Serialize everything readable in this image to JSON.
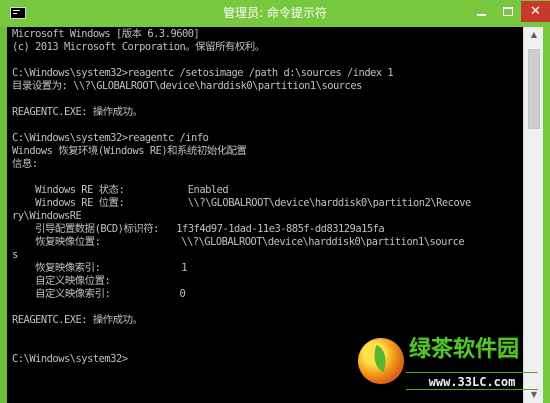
{
  "window": {
    "title": "管理员: 命令提示符",
    "minimize_label": "",
    "maximize_label": "",
    "close_label": "✕",
    "accent_color": "#78c83f",
    "close_color": "#c7382d"
  },
  "console": {
    "lines": [
      "Microsoft Windows [版本 6.3.9600]",
      "(c) 2013 Microsoft Corporation。保留所有权利。",
      "",
      "C:\\Windows\\system32>reagentc /setosimage /path d:\\sources /index 1",
      "目录设置为: \\\\?\\GLOBALROOT\\device\\harddisk0\\partition1\\sources",
      "",
      "REAGENTC.EXE: 操作成功。",
      "",
      "C:\\Windows\\system32>reagentc /info",
      "Windows 恢复环境(Windows RE)和系统初始化配置",
      "信息:",
      "",
      "    Windows RE 状态:           Enabled",
      "    Windows RE 位置:           \\\\?\\GLOBALROOT\\device\\harddisk0\\partition2\\Recove",
      "ry\\WindowsRE",
      "    引导配置数据(BCD)标识符:   1f3f4d97-1dad-11e3-885f-dd83129a15fa",
      "    恢复映像位置:              \\\\?\\GLOBALROOT\\device\\harddisk0\\partition1\\source",
      "s",
      "    恢复映像索引:              1",
      "    自定义映像位置:",
      "    自定义映像索引:            0",
      "",
      "REAGENTC.EXE: 操作成功。",
      "",
      "",
      "C:\\Windows\\system32>"
    ]
  },
  "scrollbar": {
    "up_arrow": "▲",
    "down_arrow": "▼"
  },
  "watermark": {
    "title": "绿茶软件园",
    "url": "www.33LC.com",
    "color": "#57c32f"
  }
}
